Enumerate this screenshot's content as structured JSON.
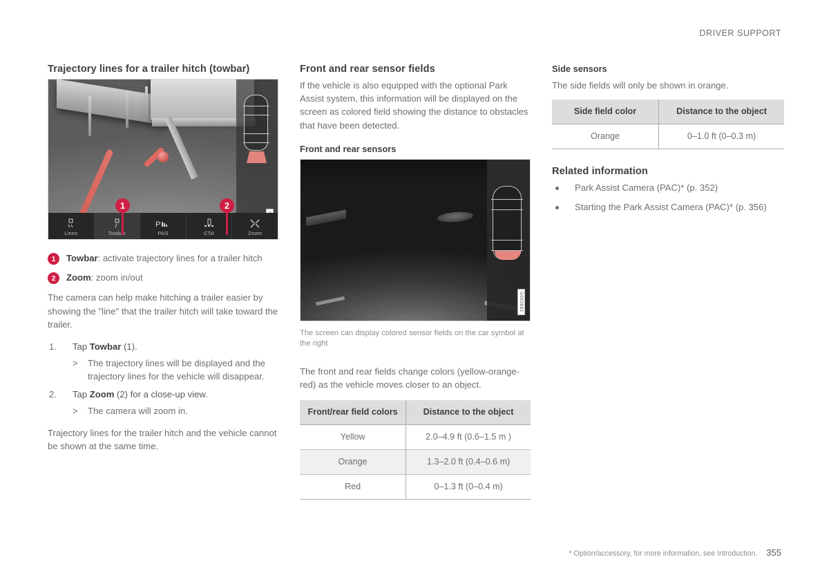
{
  "header": {
    "running_title": "DRIVER SUPPORT"
  },
  "left_column": {
    "heading": "Trajectory lines for a trailer hitch (towbar)",
    "figure": {
      "id_code": "G020817",
      "toolbar": [
        {
          "icon": "lines-icon",
          "label": "Lines"
        },
        {
          "icon": "towbar-icon",
          "label": "Towbar"
        },
        {
          "icon": "pas-icon",
          "label": "PAS"
        },
        {
          "icon": "cta-icon",
          "label": "CTA"
        },
        {
          "icon": "zoom-icon",
          "label": "Zoom"
        }
      ],
      "callouts": [
        "1",
        "2"
      ]
    },
    "key_items": [
      {
        "num": "1",
        "term": "Towbar",
        "sep": ": ",
        "desc": "activate trajectory lines for a trailer hitch"
      },
      {
        "num": "2",
        "term": "Zoom",
        "sep": ": ",
        "desc": "zoom in/out"
      }
    ],
    "intro": "The camera can help make hitching a trailer easier by showing the \"line\" that the trailer hitch will take toward the trailer.",
    "steps": [
      {
        "pre": "Tap ",
        "term": "Towbar",
        "post": " (1).",
        "result": "The trajectory lines will be displayed and the trajectory lines for the vehicle will disappear."
      },
      {
        "pre": "Tap ",
        "term": "Zoom",
        "post": " (2) for a close-up view.",
        "result": "The camera will zoom in."
      }
    ],
    "closing": "Trajectory lines for the trailer hitch and the vehicle cannot be shown at the same time."
  },
  "middle_column": {
    "heading": "Front and rear sensor fields",
    "intro": "If the vehicle is also equipped with the optional Park Assist system, this information will be displayed on the screen as colored field showing the distance to obstacles that have been detected.",
    "subheading": "Front and rear sensors",
    "figure": {
      "id_code": "G063882"
    },
    "caption": "The screen can display colored sensor fields on the car symbol at the right",
    "body": "The front and rear fields change colors (yellow-orange-red) as the vehicle moves closer to an object.",
    "table": {
      "headers": [
        "Front/rear field colors",
        "Distance to the object"
      ],
      "rows": [
        [
          "Yellow",
          "2.0–4.9 ft (0.6–1.5 m )"
        ],
        [
          "Orange",
          "1.3–2.0 ft (0.4–0.6 m)"
        ],
        [
          "Red",
          "0–1.3 ft (0–0.4 m)"
        ]
      ]
    }
  },
  "right_column": {
    "heading": "Side sensors",
    "intro": "The side fields will only be shown in orange.",
    "table": {
      "headers": [
        "Side field color",
        "Distance to the object"
      ],
      "rows": [
        [
          "Orange",
          "0–1.0 ft (0–0.3 m)"
        ]
      ]
    },
    "related_heading": "Related information",
    "related_items": [
      "Park Assist Camera (PAC)* (p. 352)",
      "Starting the Park Assist Camera (PAC)* (p. 356)"
    ]
  },
  "footer": {
    "footnote": "* Option/accessory, for more information, see Introduction.",
    "page_number": "355"
  },
  "colors": {
    "accent": "#cf1f45",
    "sensor_red": "#ef8a80",
    "table_header_bg": "#dcdddd",
    "text": "#6d6e71"
  }
}
